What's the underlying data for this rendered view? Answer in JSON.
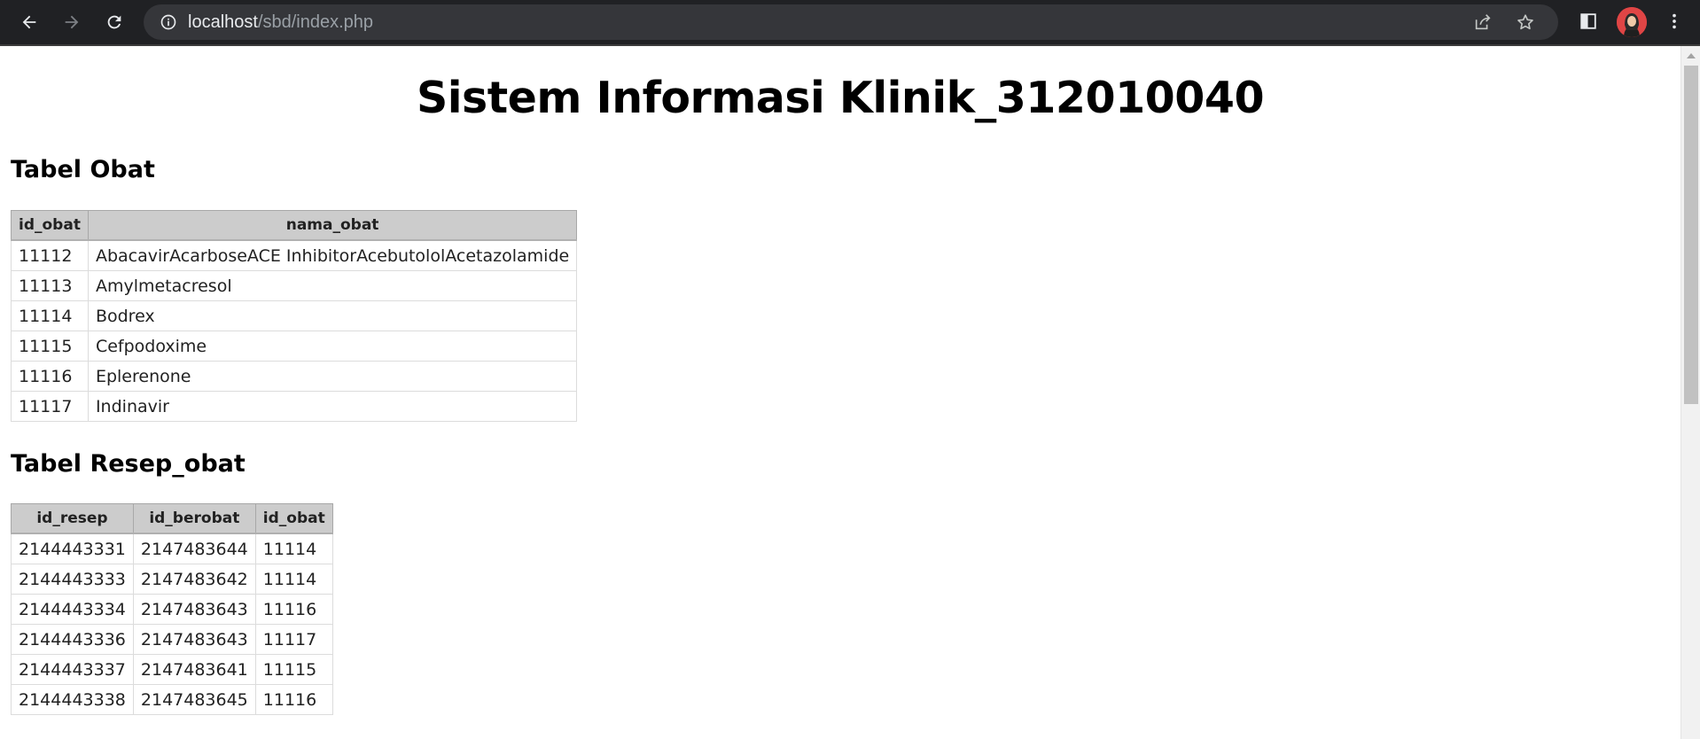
{
  "browser": {
    "url_host": "localhost",
    "url_path": "/sbd/index.php",
    "icons": {
      "back": "arrow-left-icon",
      "forward": "arrow-right-icon",
      "reload": "reload-icon",
      "site_info": "info-icon",
      "share": "share-icon",
      "bookmark": "star-icon",
      "side_panel": "side-panel-icon",
      "menu": "kebab-menu-icon"
    },
    "colors": {
      "toolbar": "#202124",
      "omnibox": "#35363a",
      "url_host": "#e8eaed",
      "url_path": "#9aa0a6"
    }
  },
  "page": {
    "title": "Sistem Informasi Klinik_312010040",
    "obat_section": {
      "heading": "Tabel Obat",
      "columns": [
        "id_obat",
        "nama_obat"
      ],
      "rows": [
        [
          "11112",
          "AbacavirAcarboseACE InhibitorAcebutololAcetazolamide"
        ],
        [
          "11113",
          "Amylmetacresol"
        ],
        [
          "11114",
          "Bodrex"
        ],
        [
          "11115",
          "Cefpodoxime"
        ],
        [
          "11116",
          "Eplerenone"
        ],
        [
          "11117",
          "Indinavir"
        ]
      ]
    },
    "resep_section": {
      "heading": "Tabel Resep_obat",
      "columns": [
        "id_resep",
        "id_berobat",
        "id_obat"
      ],
      "rows": [
        [
          "2144443331",
          "2147483644",
          "11114"
        ],
        [
          "2144443333",
          "2147483642",
          "11114"
        ],
        [
          "2144443334",
          "2147483643",
          "11116"
        ],
        [
          "2144443336",
          "2147483643",
          "11117"
        ],
        [
          "2144443337",
          "2147483641",
          "11115"
        ],
        [
          "2144443338",
          "2147483645",
          "11116"
        ]
      ]
    },
    "colors": {
      "table_header_bg": "#cccccc",
      "page_bg": "#ffffff"
    }
  }
}
